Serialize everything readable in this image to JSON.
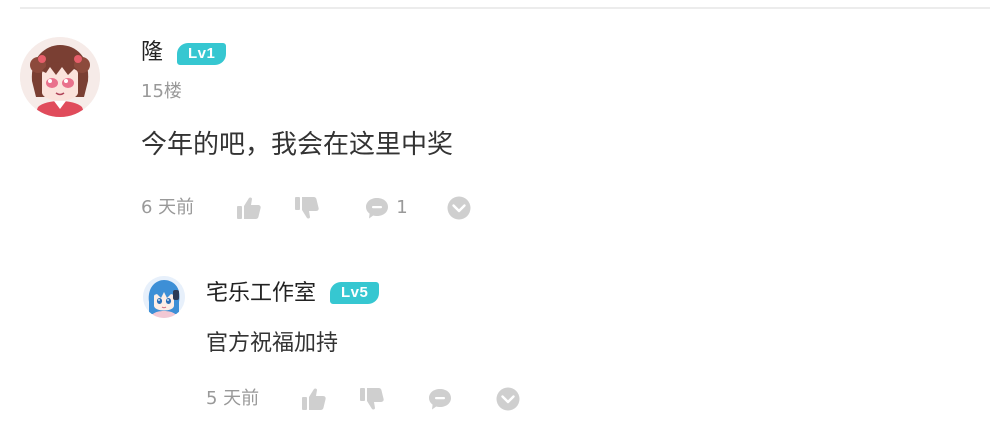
{
  "comment": {
    "username": "隆",
    "level": "Lv1",
    "floor": "15楼",
    "text": "今年的吧，我会在这里中奖",
    "time": "6 天前",
    "reply_count": "1",
    "icons": [
      "avatar",
      "thumbs-up-icon",
      "thumbs-down-icon",
      "comment-bubble-icon",
      "more-chevron-icon"
    ]
  },
  "reply": {
    "username": "宅乐工作室",
    "level": "Lv5",
    "text": "官方祝福加持",
    "time": "5 天前",
    "icons": [
      "avatar",
      "thumbs-up-icon",
      "thumbs-down-icon",
      "comment-bubble-icon",
      "more-chevron-icon"
    ]
  },
  "colors": {
    "level_badge": "#36c7d1",
    "muted_text": "#999999",
    "icon_gray": "#cccccc",
    "divider": "#ececec"
  }
}
